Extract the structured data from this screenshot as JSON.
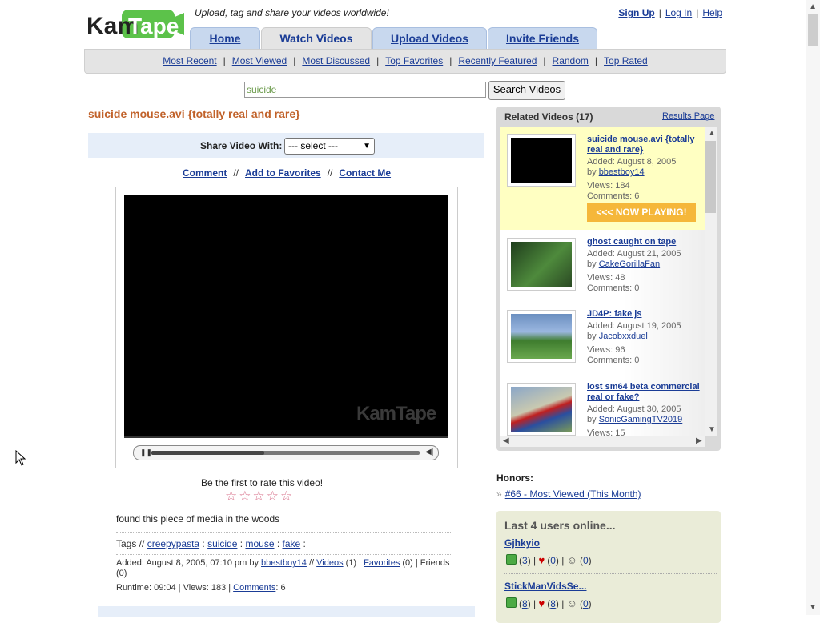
{
  "header": {
    "logo_text_1": "Kam",
    "logo_text_2": "Tape",
    "tagline": "Upload, tag and share your videos worldwide!",
    "links": {
      "signup": "Sign Up",
      "login": "Log In",
      "help": "Help"
    }
  },
  "tabs": [
    "Home",
    "Watch Videos",
    "Upload Videos",
    "Invite Friends"
  ],
  "active_tab": "Watch Videos",
  "subnav": [
    "Most Recent",
    "Most Viewed",
    "Most Discussed",
    "Top Favorites",
    "Recently Featured",
    "Random",
    "Top Rated"
  ],
  "search": {
    "value": "suicide",
    "button": "Search Videos"
  },
  "video": {
    "title": "suicide mouse.avi {totally real and rare}",
    "share_label": "Share Video With:",
    "share_select": "--- select ---",
    "actions": {
      "comment": "Comment",
      "favorites": "Add to Favorites",
      "contact": "Contact Me"
    },
    "watermark": "KamTape",
    "playback_fraction": 0.42,
    "rate_text": "Be the first to rate this video!",
    "stars": "☆☆☆☆☆",
    "description": "found this piece of media in the woods",
    "tags_label": "Tags //",
    "tags": [
      "creepypasta",
      "suicide",
      "mouse",
      "fake"
    ],
    "meta": {
      "added_prefix": "Added: August 8, 2005, 07:10 pm by",
      "user": "bbestboy14",
      "videos_link": "Videos",
      "videos_count": "(1) |",
      "favorites_link": "Favorites",
      "favorites_count": "(0) | Friends (0)",
      "runtime_prefix": "Runtime: 09:04 | Views: 183 |",
      "comments_link": "Comments",
      "comments_count": ": 6"
    }
  },
  "related": {
    "title": "Related Videos (17)",
    "results_link": "Results Page",
    "now_playing": "<<< NOW PLAYING!",
    "items": [
      {
        "title": "suicide mouse.avi {totally real and rare}",
        "added": "Added: August 8, 2005",
        "by_label": "by",
        "user": "bbestboy14",
        "views": "Views: 184",
        "comments": "Comments: 6",
        "thumb_color": "#000000"
      },
      {
        "title": "ghost caught on tape",
        "added": "Added: August 21, 2005",
        "by_label": "by",
        "user": "CakeGorillaFan",
        "views": "Views: 48",
        "comments": "Comments: 0",
        "thumb_color": "#2f5a2a"
      },
      {
        "title": "JD4P: fake js",
        "added": "Added: August 19, 2005",
        "by_label": "by",
        "user": "Jacobxxduel",
        "views": "Views: 96",
        "comments": "Comments: 0",
        "thumb_color": "#6b8fc0"
      },
      {
        "title": "lost sm64 beta commercial real or fake?",
        "added": "Added: August 30, 2005",
        "by_label": "by",
        "user": "SonicGamingTV2019",
        "views": "Views: 15",
        "comments": "",
        "thumb_color": "#8aa6c8"
      }
    ]
  },
  "honors": {
    "heading": "Honors:",
    "mark": "»",
    "link": "#66 - Most Viewed (This Month)"
  },
  "online": {
    "title": "Last 4 users online...",
    "users": [
      {
        "name": "Gjhkyio",
        "videos": "3",
        "favorites": "0",
        "friends": "0"
      },
      {
        "name": "StickManVidsSe...",
        "videos": "8",
        "favorites": "8",
        "friends": "0"
      }
    ]
  }
}
